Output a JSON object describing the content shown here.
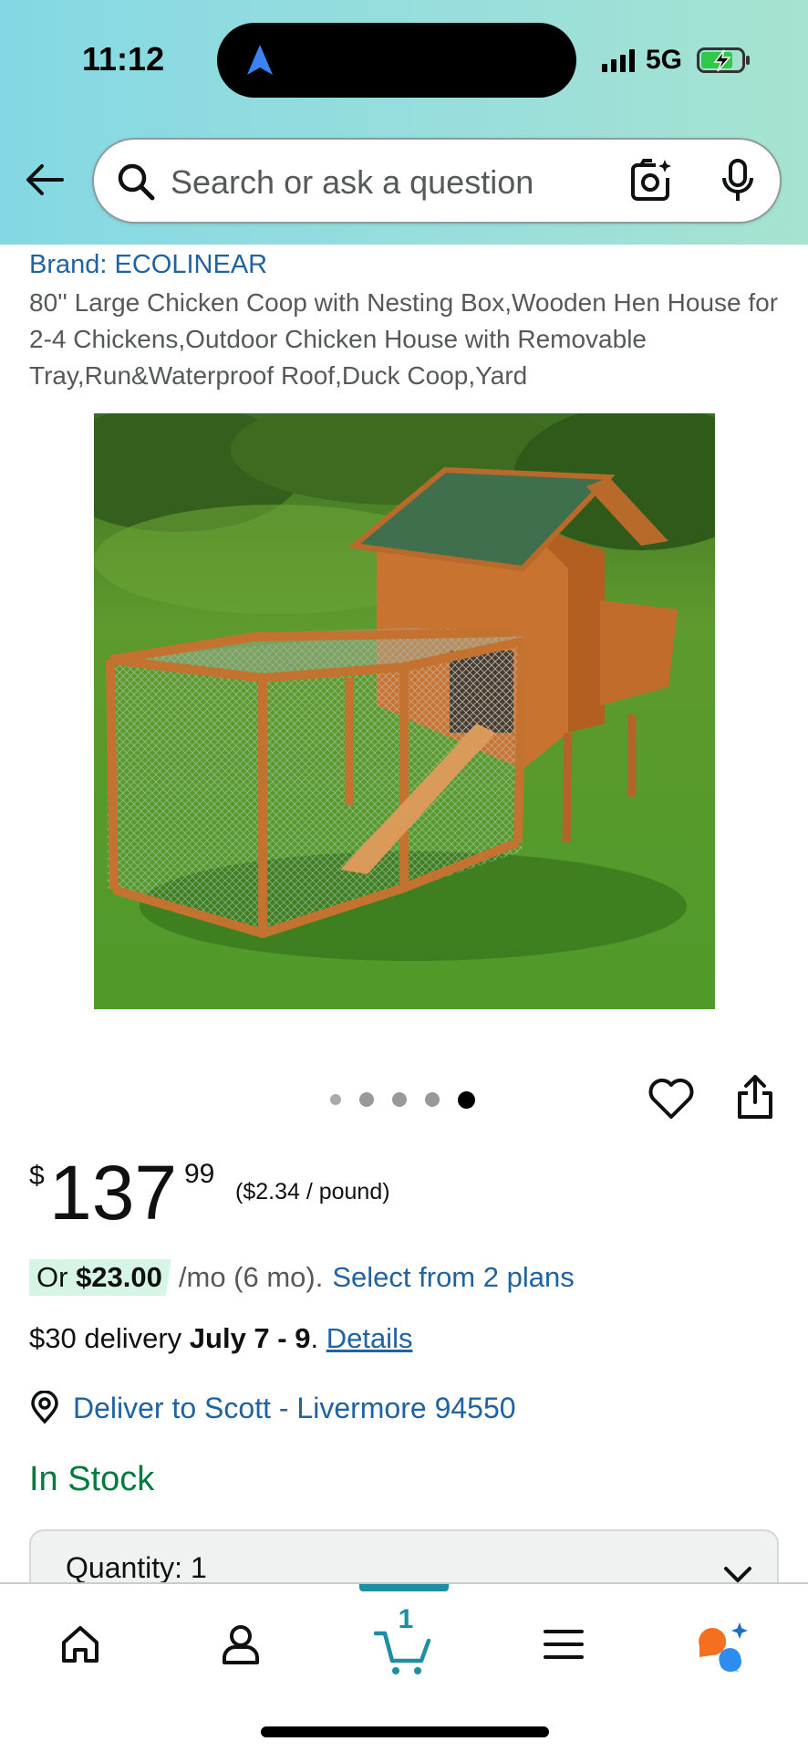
{
  "status_bar": {
    "time": "11:12",
    "network": "5G"
  },
  "search": {
    "placeholder": "Search or ask a question"
  },
  "product": {
    "brand": "Brand: ECOLINEAR",
    "title": "80'' Large Chicken Coop with Nesting Box,Wooden Hen House for 2-4 Chickens,Outdoor Chicken House with Removable Tray,Run&Waterproof Roof,Duck Coop,Yard",
    "image_alt": "Wooden chicken coop with green roof and wire run on grass",
    "image_count": 5,
    "active_image": 5
  },
  "price": {
    "symbol": "$",
    "whole": "137",
    "fraction": "99",
    "unit_price": "($2.34 / pound)"
  },
  "installment": {
    "prefix": "Or ",
    "amount": "$23.00",
    "term": " /mo (6 mo).",
    "link": "Select from 2 plans"
  },
  "delivery": {
    "cost": "$30 delivery ",
    "dates": "July 7 - 9",
    "separator": ". ",
    "details_link": "Details"
  },
  "location": {
    "label": "Deliver to Scott - Livermore 94550"
  },
  "stock": {
    "status": "In Stock"
  },
  "quantity": {
    "label": "Quantity: 1"
  },
  "nav": {
    "cart_count": "1"
  },
  "colors": {
    "link": "#2162a1",
    "in_stock": "#007a3d",
    "cart_accent": "#1d8fa2",
    "installment_highlight": "#d7f5e5"
  }
}
